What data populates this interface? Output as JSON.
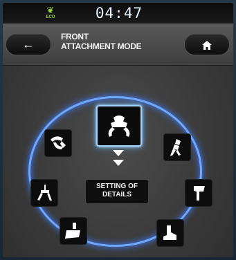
{
  "status_bar": {
    "eco_label": "ECO",
    "eco_icon": "leaf-icon",
    "clock": "04:47"
  },
  "header": {
    "back_icon": "arrow-left-icon",
    "home_icon": "home-icon",
    "title_line1": "FRONT",
    "title_line2": "ATTACHMENT MODE"
  },
  "mode_selector": {
    "selected_icon": "grapple-attachment-icon",
    "details_line1": "SETTING OF",
    "details_line2": "DETAILS",
    "items": [
      {
        "icon": "grapple-claw-icon"
      },
      {
        "icon": "breaker-attachment-icon"
      },
      {
        "icon": "clamp-attachment-icon"
      },
      {
        "icon": "ripper-attachment-icon"
      },
      {
        "icon": "bucket-attachment-icon"
      },
      {
        "icon": "pusher-attachment-icon"
      }
    ]
  },
  "colors": {
    "ring_glow": "#6fa8ff",
    "eco_green": "#9bd23a"
  }
}
